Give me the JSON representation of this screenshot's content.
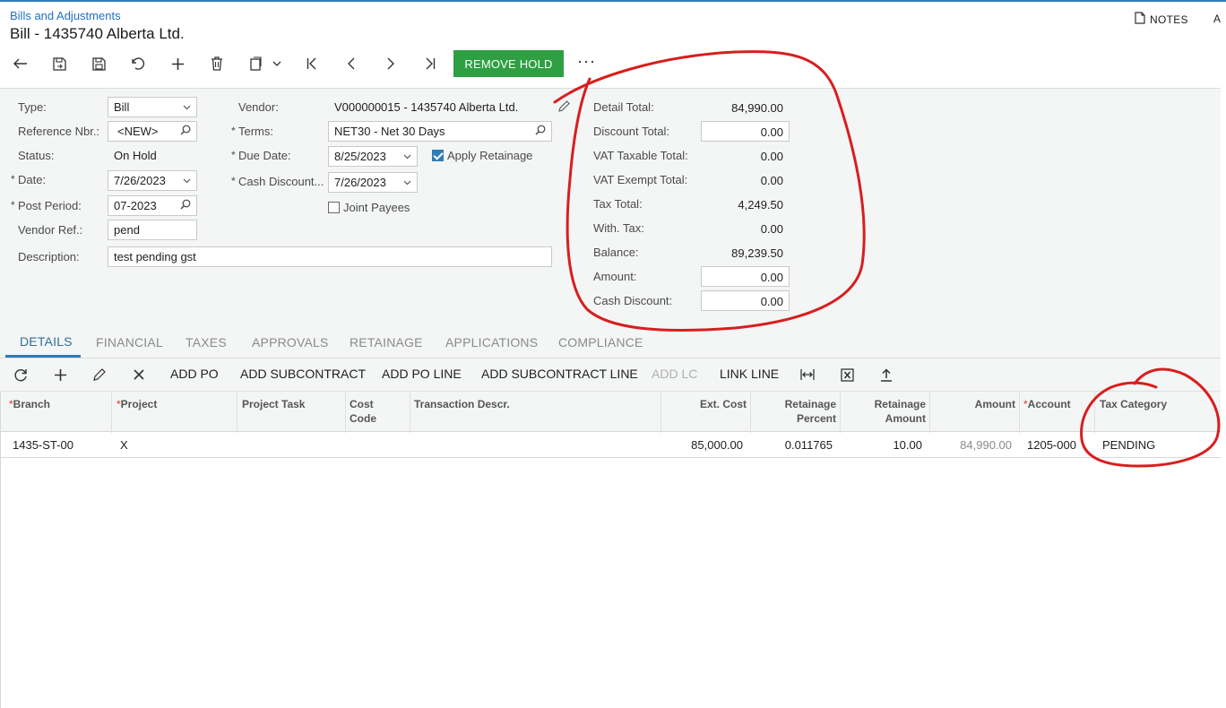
{
  "header": {
    "breadcrumb": "Bills and Adjustments",
    "title": "Bill - 1435740 Alberta Ltd.",
    "notes_label": "NOTES",
    "truncated_label": "A"
  },
  "toolbar": {
    "remove_hold_label": "REMOVE HOLD",
    "more_label": "···",
    "accent_color": "#2ea043"
  },
  "form": {
    "type_label": "Type:",
    "type_value": "Bill",
    "refnbr_label": "Reference Nbr.:",
    "refnbr_value": "<NEW>",
    "status_label": "Status:",
    "status_value": "On Hold",
    "date_label": "Date:",
    "date_value": "7/26/2023",
    "postperiod_label": "Post Period:",
    "postperiod_value": "07-2023",
    "vendorref_label": "Vendor Ref.:",
    "vendorref_value": "pend",
    "description_label": "Description:",
    "description_value": "test pending gst",
    "vendor_label": "Vendor:",
    "vendor_value": "V000000015 - 1435740 Alberta Ltd.",
    "terms_label": "Terms:",
    "terms_value": "NET30 - Net 30 Days",
    "duedate_label": "Due Date:",
    "duedate_value": "8/25/2023",
    "cashdiscount_label": "Cash Discount...",
    "cashdiscount_value": "7/26/2023",
    "apply_retainage_label": "Apply Retainage",
    "apply_retainage_checked": true,
    "joint_payees_label": "Joint Payees",
    "joint_payees_checked": false
  },
  "summary": {
    "detail_total_label": "Detail Total:",
    "detail_total": "84,990.00",
    "discount_total_label": "Discount Total:",
    "discount_total": "0.00",
    "vat_taxable_label": "VAT Taxable Total:",
    "vat_taxable": "0.00",
    "vat_exempt_label": "VAT Exempt Total:",
    "vat_exempt": "0.00",
    "tax_total_label": "Tax Total:",
    "tax_total": "4,249.50",
    "with_tax_label": "With. Tax:",
    "with_tax": "0.00",
    "balance_label": "Balance:",
    "balance": "89,239.50",
    "amount_label": "Amount:",
    "amount": "0.00",
    "cash_discount_label": "Cash Discount:",
    "cash_discount": "0.00"
  },
  "tabs": [
    "DETAILS",
    "FINANCIAL",
    "TAXES",
    "APPROVALS",
    "RETAINAGE",
    "APPLICATIONS",
    "COMPLIANCE"
  ],
  "grid_toolbar": {
    "add_po": "ADD PO",
    "add_subcontract": "ADD SUBCONTRACT",
    "add_po_line": "ADD PO LINE",
    "add_subcontract_line": "ADD SUBCONTRACT LINE",
    "add_lc": "ADD LC",
    "link_line": "LINK LINE"
  },
  "grid": {
    "columns": {
      "branch": "Branch",
      "project": "Project",
      "project_task": "Project Task",
      "cost_code_1": "Cost",
      "cost_code_2": "Code",
      "transaction_descr": "Transaction Descr.",
      "ext_cost": "Ext. Cost",
      "retainage_percent_1": "Retainage",
      "retainage_percent_2": "Percent",
      "retainage_amount_1": "Retainage",
      "retainage_amount_2": "Amount",
      "amount": "Amount",
      "account": "Account",
      "tax_category": "Tax Category"
    },
    "rows": [
      {
        "branch": "1435-ST-00",
        "project": "X",
        "project_task": "",
        "cost_code": "",
        "transaction_descr": "",
        "ext_cost": "85,000.00",
        "retainage_percent": "0.011765",
        "retainage_amount": "10.00",
        "amount": "84,990.00",
        "account": "1205-000",
        "tax_category": "PENDING"
      }
    ]
  },
  "annotation_color": "#d81e1e"
}
